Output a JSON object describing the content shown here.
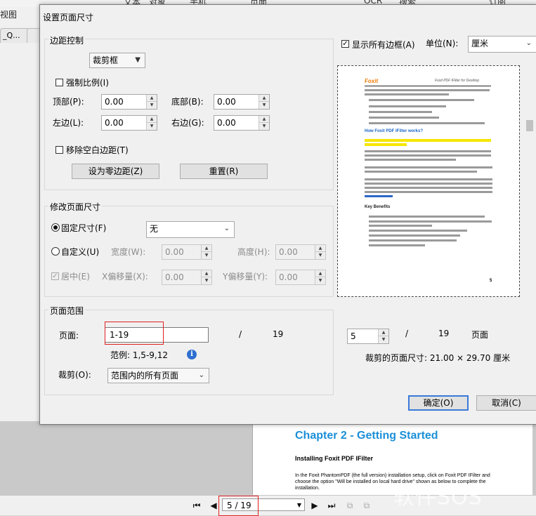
{
  "app": {
    "ribbon_items": [
      "文本",
      "对象",
      "手机",
      "页面",
      "OCR",
      "搜索",
      "订阅"
    ],
    "view_label": "视图",
    "doc_tabs": [
      "_Q...",
      ""
    ],
    "document": {
      "chapter_title": "Chapter 2 - Getting Started",
      "section_title": "Installing Foxit PDF IFilter",
      "paragraph": "In the Foxit PhantomPDF (the full version) installation setup, click on Foxit PDF IFilter and choose the option \"Will be installed on local hard drive\" shown as below to complete the installation."
    },
    "status_bar": {
      "page_display": "5 / 19"
    },
    "watermark": "软件SOS"
  },
  "dialog": {
    "title": "设置页面尺寸",
    "margin_control": {
      "legend": "边距控制",
      "box_select": "裁剪框",
      "force_ratio_label": "强制比例(I)",
      "force_ratio_checked": false,
      "top_label": "顶部(P):",
      "top_value": "0.00",
      "bottom_label": "底部(B):",
      "bottom_value": "0.00",
      "left_label": "左边(L):",
      "left_value": "0.00",
      "right_label": "右边(G):",
      "right_value": "0.00",
      "remove_blank_label": "移除空白边距(T)",
      "remove_blank_checked": false,
      "zero_margin_button": "设为零边距(Z)",
      "reset_button": "重置(R)"
    },
    "page_size": {
      "legend": "修改页面尺寸",
      "fixed_label": "固定尺寸(F)",
      "fixed_selected": true,
      "fixed_value": "无",
      "custom_label": "自定义(U)",
      "width_label": "宽度(W):",
      "width_value": "0.00",
      "height_label": "高度(H):",
      "height_value": "0.00",
      "center_label": "居中(E)",
      "center_checked": true,
      "xoffset_label": "X偏移量(X):",
      "xoffset_value": "0.00",
      "yoffset_label": "Y偏移量(Y):",
      "yoffset_value": "0.00"
    },
    "page_range": {
      "legend": "页面范围",
      "pages_label": "页面:",
      "pages_value": "1-19",
      "slash": "/",
      "total": "19",
      "example": "范例: 1,5-9,12",
      "crop_label": "裁剪(O):",
      "crop_value": "范围内的所有页面"
    },
    "show_all_boxes_label": "显示所有边框(A)",
    "show_all_boxes_checked": true,
    "unit_label": "单位(N):",
    "unit_value": "厘米",
    "preview_page": {
      "value": "5",
      "slash": "/",
      "total": "19",
      "page_word": "页面",
      "crop_size_text": "裁剪的页面尺寸: 21.00 × 29.70  厘米"
    },
    "preview_doc": {
      "logo": "Foxit",
      "header_right": "Foxit PDF IFilter for Desktop",
      "heading1": "How Foxit PDF IFilter works?",
      "heading2": "Key Benefits",
      "page_number": "5"
    },
    "ok_button": "确定(O)",
    "cancel_button": "取消(C)"
  }
}
